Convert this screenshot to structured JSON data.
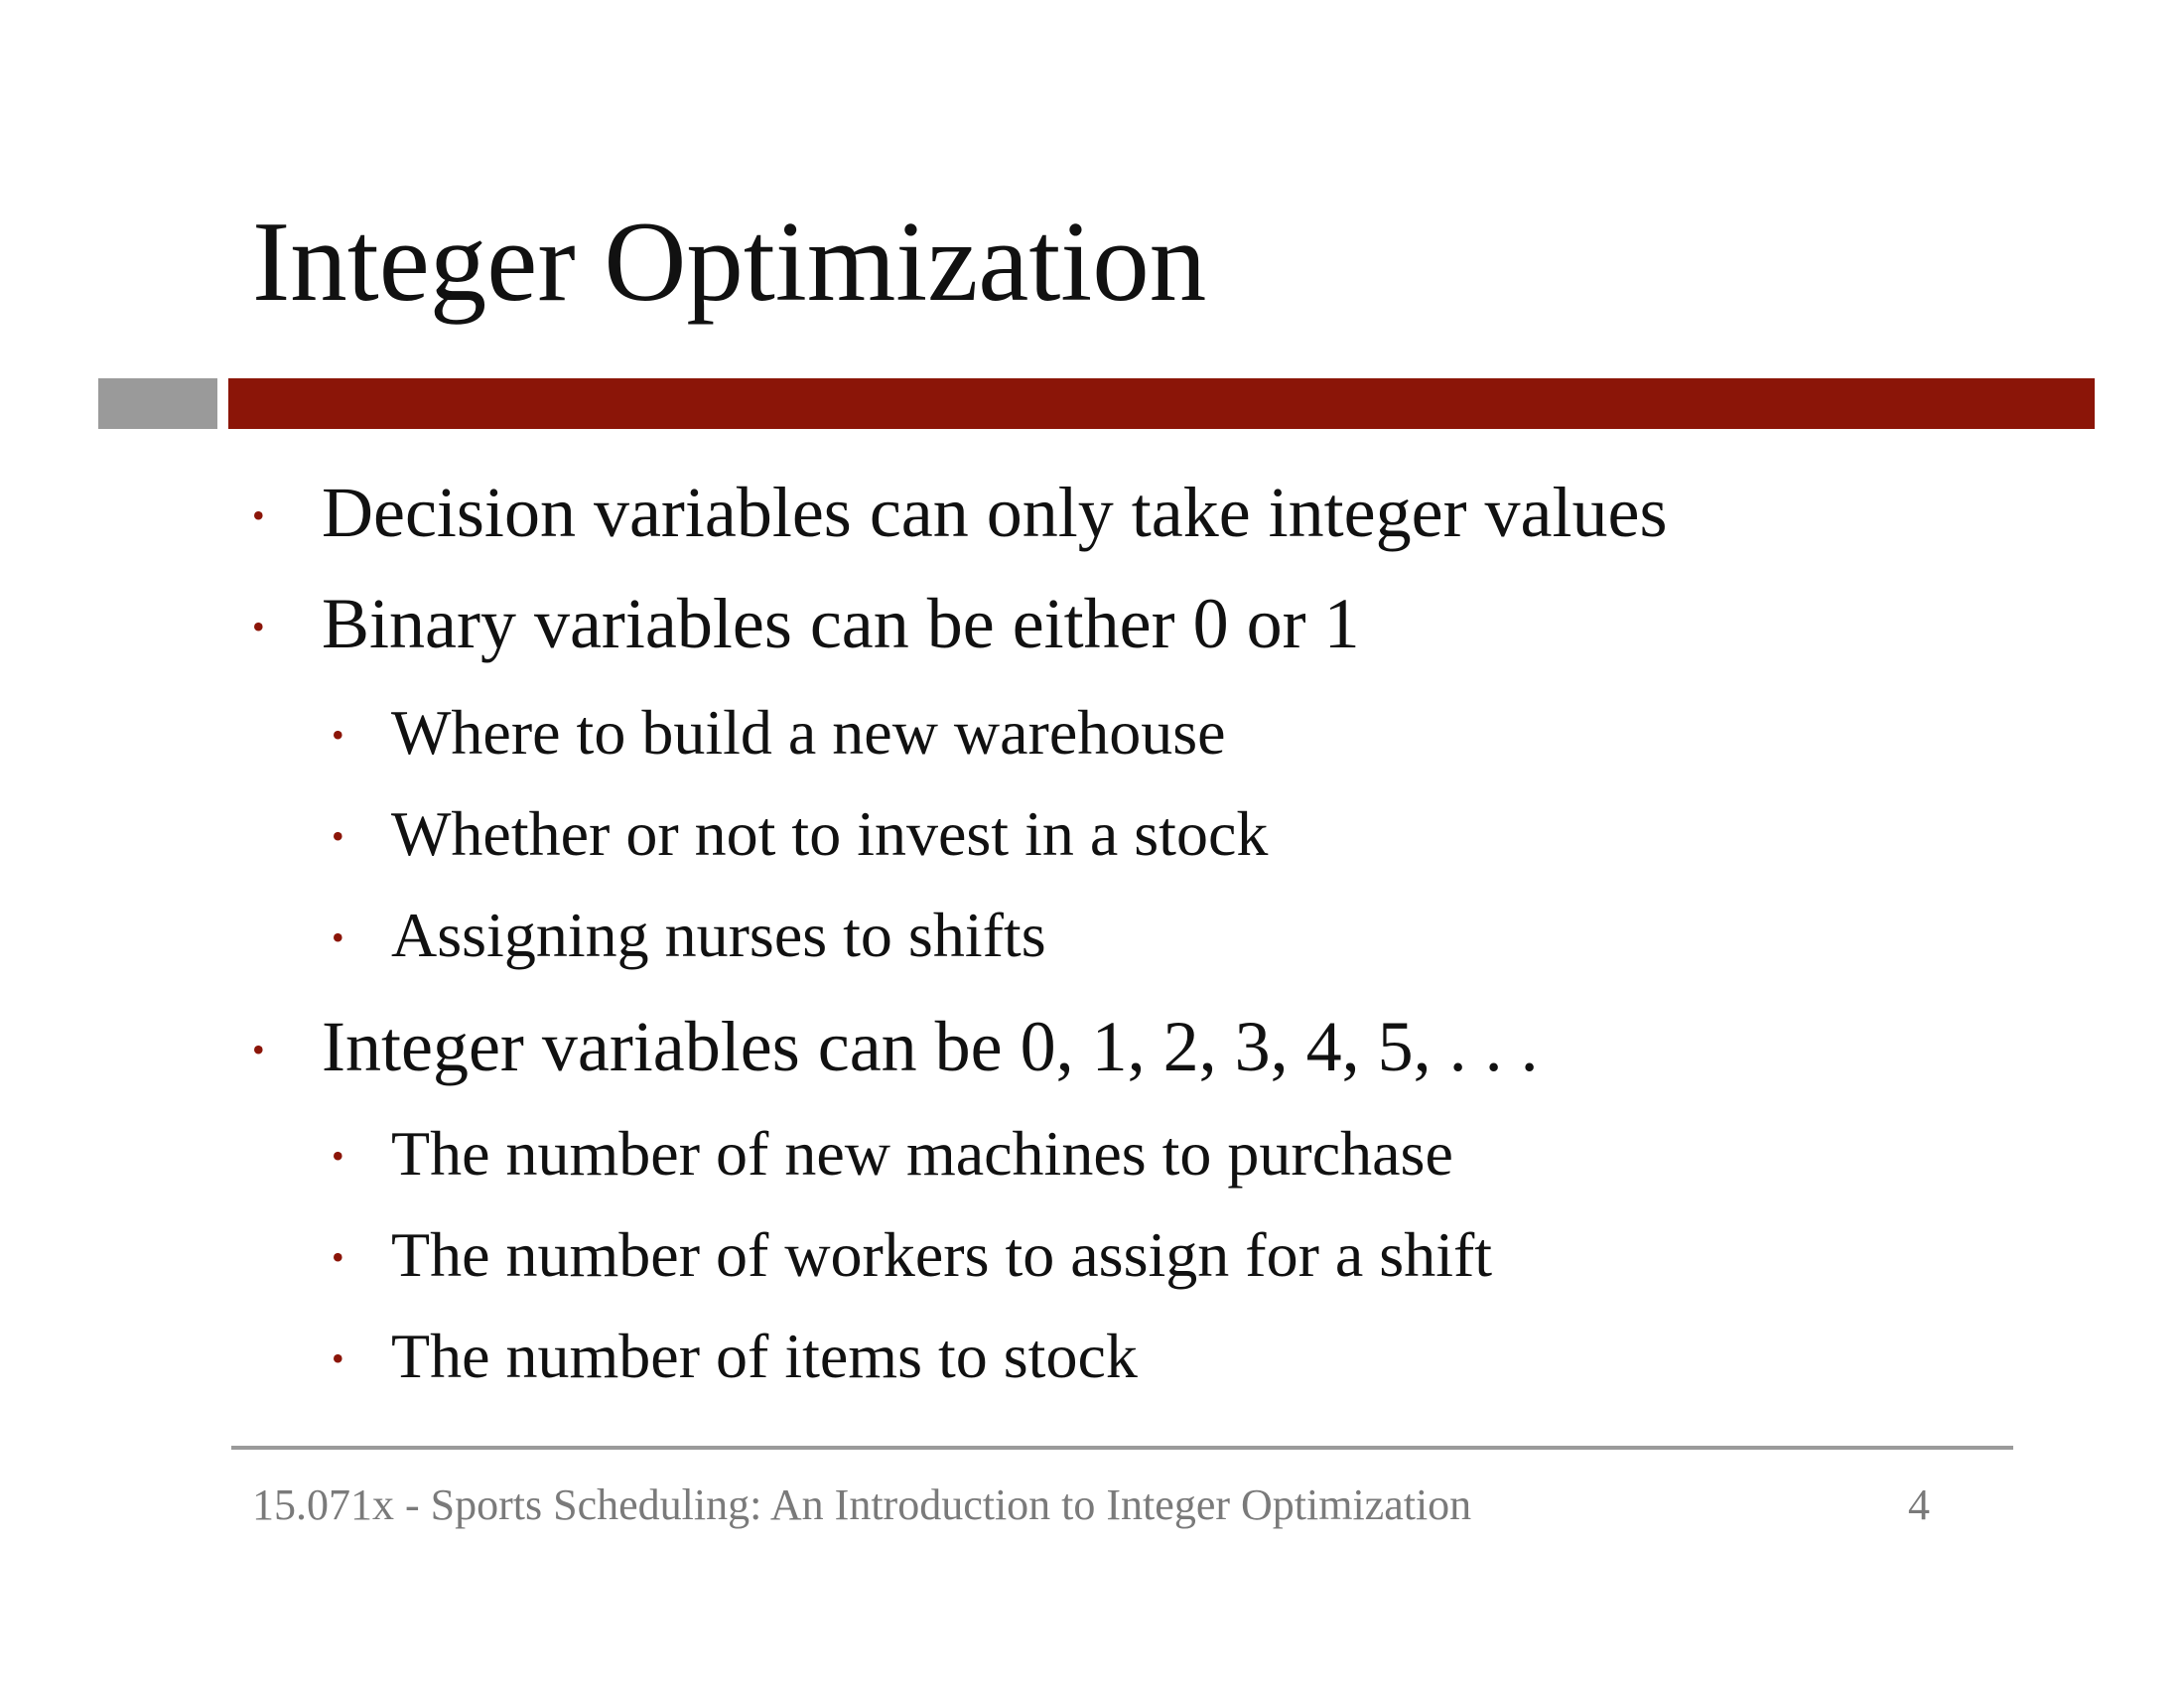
{
  "slide": {
    "title": "Integer Optimization",
    "bullet_glyph": "•",
    "bullets": [
      {
        "text": "Decision variables can only take integer values"
      },
      {
        "text": "Binary variables can be either 0 or 1"
      },
      {
        "text": "Where to build a new warehouse"
      },
      {
        "text": "Whether or not to invest in a stock"
      },
      {
        "text": "Assigning nurses to shifts"
      },
      {
        "text": "Integer variables can be 0, 1, 2, 3, 4, 5, . . ."
      },
      {
        "text": "The number of new machines to purchase"
      },
      {
        "text": "The number of workers to assign for a shift"
      },
      {
        "text": "The number of items to stock"
      }
    ]
  },
  "footer": {
    "text": "15.071x - Sports Scheduling: An Introduction to Integer Optimization",
    "page_number": "4"
  },
  "colors": {
    "accent_red": "#8b1508",
    "accent_gray": "#9a9a9a",
    "footer_text": "#7a7a7a"
  }
}
